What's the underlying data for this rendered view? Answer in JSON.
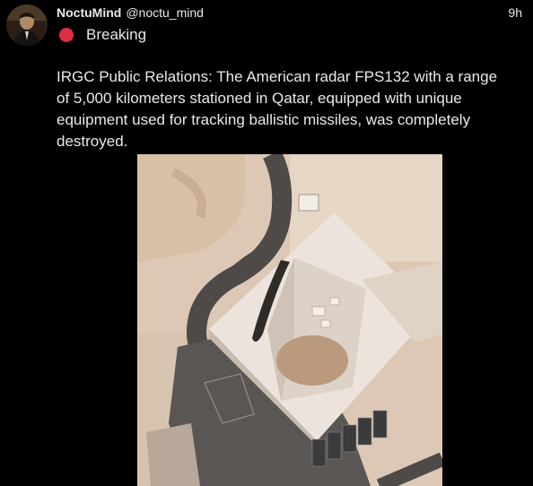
{
  "post": {
    "display_name": "NoctuMind",
    "handle": "@noctu_mind",
    "time": "9h",
    "breaking_label": "Breaking",
    "text": "IRGC Public Relations: The American radar FPS132 with a range of 5,000 kilometers stationed in Qatar, equipped with unique equipment used for tracking ballistic missiles, was completely destroyed.",
    "icons": {
      "status": "red-circle-icon",
      "avatar": "profile-photo"
    },
    "colors": {
      "background": "#000000",
      "text": "#e7e9ea",
      "status_dot": "#dd2e44"
    }
  }
}
